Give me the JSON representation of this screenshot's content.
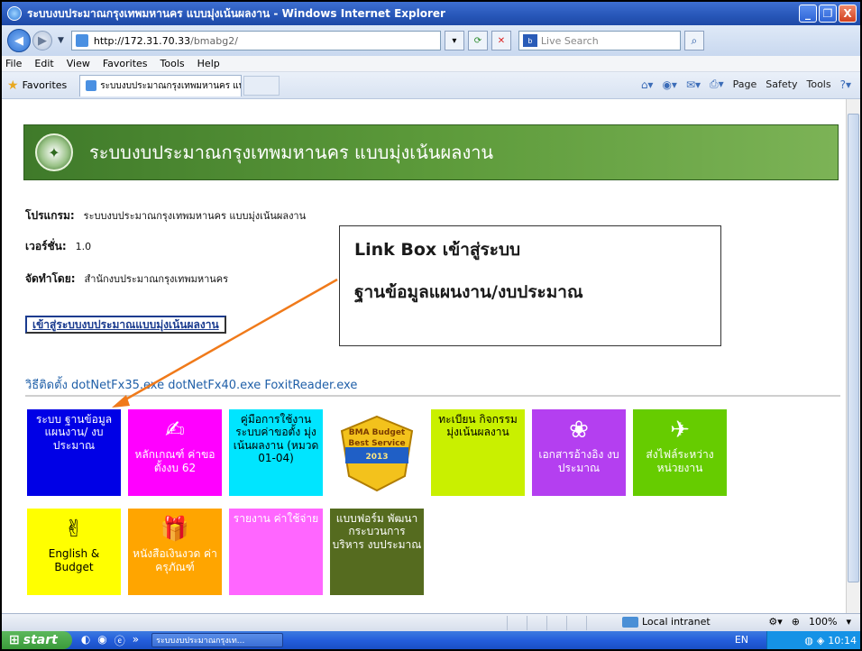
{
  "window": {
    "title": "ระบบงบประมาณกรุงเทพมหานคร แบบมุ่งเน้นผลงาน - Windows Internet Explorer",
    "minimize": "_",
    "restore": "❐",
    "close": "X"
  },
  "address": {
    "url_host": "http://172.31.70.33",
    "url_path": "/bmabg2/",
    "live_search_placeholder": "Live Search",
    "live_badge": "b"
  },
  "menu": [
    "File",
    "Edit",
    "View",
    "Favorites",
    "Tools",
    "Help"
  ],
  "favbar": {
    "favorites_label": "Favorites",
    "tab_title": "ระบบงบประมาณกรุงเทพมหานคร แบบมุ่งเน้นผลงาน",
    "page": "Page",
    "safety": "Safety",
    "tools": "Tools"
  },
  "page": {
    "banner_title": "ระบบงบประมาณกรุงเทพมหานคร แบบมุ่งเน้นผลงาน",
    "program_key": "โปรแกรม:",
    "program_value": "ระบบงบประมาณกรุงเทพมหานคร แบบมุ่งเน้นผลงาน",
    "version_key": "เวอร์ชั่น:",
    "version_value": "1.0",
    "by_key": "จัดทำโดย:",
    "by_value": "สำนักงบประมาณกรุงเทพมหานคร",
    "enter_button": "เข้าสู่ระบบงบประมาณแบบมุ่งเน้นผลงาน",
    "callout_line1": "Link Box เข้าสู่ระบบ",
    "callout_line2": "ฐานข้อมูลแผนงาน/งบประมาณ",
    "install_link": "วิธีติดตั้ง dotNetFx35.exe dotNetFx40.exe FoxitReader.exe"
  },
  "tiles": [
    {
      "label": "ระบบ ฐานข้อมูล แผนงาน/ งบประมาณ",
      "bg": "#0000e6",
      "fg": "#ffffff",
      "icon": ""
    },
    {
      "label": "หลักเกณฑ์ ค่าขอตั้งงบ 62",
      "bg": "#ff00ff",
      "fg": "#ffffff",
      "icon": "✍"
    },
    {
      "label": "คู่มือการใช้งาน ระบบค่าขอตั้ง มุ่งเน้นผลงาน (หมวด 01-04)",
      "bg": "#00e5ff",
      "fg": "#000000",
      "icon": ""
    },
    {
      "label": "BMA Budget Best Service 2013",
      "bg": "#ffffff",
      "fg": "#7a3b00",
      "icon": "badge"
    },
    {
      "label": "ทะเบียน กิจกรรม มุ่งเน้นผลงาน",
      "bg": "#c9f000",
      "fg": "#000000",
      "icon": ""
    },
    {
      "label": "เอกสารอ้างอิง งบประมาณ",
      "bg": "#b43ff0",
      "fg": "#ffffff",
      "icon": "❀"
    },
    {
      "label": "ส่งไฟล์ระหว่าง หน่วยงาน",
      "bg": "#66cc00",
      "fg": "#ffffff",
      "icon": "✈"
    },
    {
      "label": "English & Budget",
      "bg": "#ffff00",
      "fg": "#000000",
      "icon": "✌"
    },
    {
      "label": "หนังสือเงินงวด ค่าครุภัณฑ์",
      "bg": "#ffa500",
      "fg": "#ffffff",
      "icon": "🎁"
    },
    {
      "label": "รายงาน ค่าใช้จ่าย",
      "bg": "#ff66ff",
      "fg": "#ffffff",
      "icon": ""
    },
    {
      "label": "แบบฟอร์ม พัฒนา กระบวนการ บริหาร งบประมาณ",
      "bg": "#556b1f",
      "fg": "#ffffff",
      "icon": ""
    }
  ],
  "status": {
    "zone": "Local intranet",
    "zoom": "100%"
  },
  "taskbar": {
    "start": "start",
    "task_title": "ระบบงบประมาณกรุงเท...",
    "lang": "EN",
    "clock": "10:14"
  }
}
